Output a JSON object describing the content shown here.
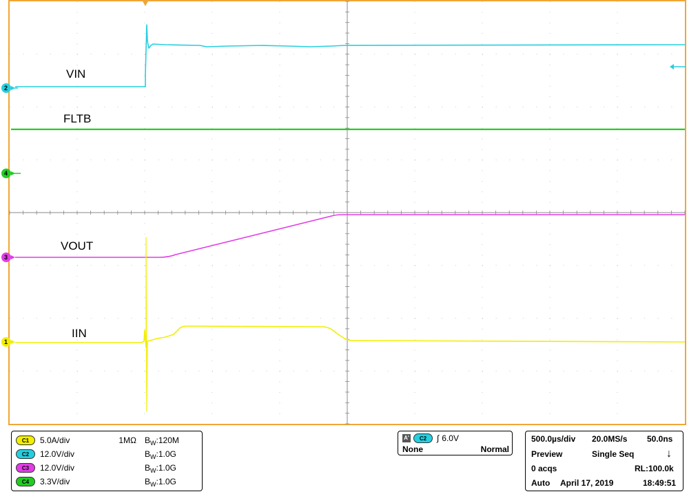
{
  "colors": {
    "frame": "#f0a636",
    "grid": "#b8b8b8",
    "divider": "#888888",
    "ch1": "#f2ee00",
    "ch2": "#24cfe0",
    "ch3": "#e13ce6",
    "ch4": "#22cc22"
  },
  "traces": {
    "vin": {
      "label": "VIN",
      "marker": "2"
    },
    "fltb": {
      "label": "FLTB",
      "marker": null
    },
    "ch4": {
      "marker": "4"
    },
    "vout": {
      "label": "VOUT",
      "marker": "3"
    },
    "iin": {
      "label": "IIN",
      "marker": "1"
    }
  },
  "channels": [
    {
      "id": "C1",
      "scale": "5.0A/div",
      "impedance": "1MΩ",
      "bw_prefix": "B",
      "bw_sub": "W",
      "bw_value": ":120M"
    },
    {
      "id": "C2",
      "scale": "12.0V/div",
      "impedance": "",
      "bw_prefix": "B",
      "bw_sub": "W",
      "bw_value": ":1.0G"
    },
    {
      "id": "C3",
      "scale": "12.0V/div",
      "impedance": "",
      "bw_prefix": "B",
      "bw_sub": "W",
      "bw_value": ":1.0G"
    },
    {
      "id": "C4",
      "scale": "3.3V/div",
      "impedance": "",
      "bw_prefix": "B",
      "bw_sub": "W",
      "bw_value": ":1.0G"
    }
  ],
  "trigger": {
    "badge": "A'",
    "source": "C2",
    "level": "6.0V",
    "coupling": "None",
    "mode": "Normal"
  },
  "timebase": {
    "horizontal_scale": "500.0µs/div",
    "sample_rate": "20.0MS/s",
    "resolution": "50.0ns",
    "acq_mode": "Preview",
    "sequence": "Single Seq",
    "acqs": "0 acqs",
    "record_length": "RL:100.0k",
    "trigger_mode": "Auto",
    "date": "April 17, 2019",
    "time": "18:49:51"
  }
}
